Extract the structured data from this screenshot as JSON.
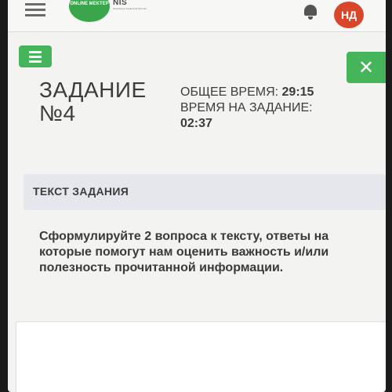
{
  "header": {
    "brand_logo_text": "ONLINE MEKTEP",
    "nis_logo_text": "NIS",
    "nis_logo_subtext": "Nazarbayev Intellectual Schools",
    "avatar_initials": "НД"
  },
  "task": {
    "title_line1": "ЗАДАНИЕ",
    "title_line2": "№4",
    "total_time_label": "ОБЩЕЕ ВРЕМЯ:",
    "total_time_value": "29:15",
    "task_time_label": "ВРЕМЯ НА ЗАДАНИЕ:",
    "task_time_value": "02:37",
    "section_label": "ТЕКСТ ЗАДАНИЯ",
    "text": "Сформулируйте 2 вопроса к тексту, ответы на которые помогут нам оценить важность и/или полезность прочитанной информации."
  },
  "icons": {
    "menu": "menu-icon",
    "bell": "bell-icon",
    "close": "close-icon"
  },
  "colors": {
    "accent_green": "#45b45a",
    "avatar_red": "#d9472a",
    "panel_gray": "#e6e7ed"
  }
}
